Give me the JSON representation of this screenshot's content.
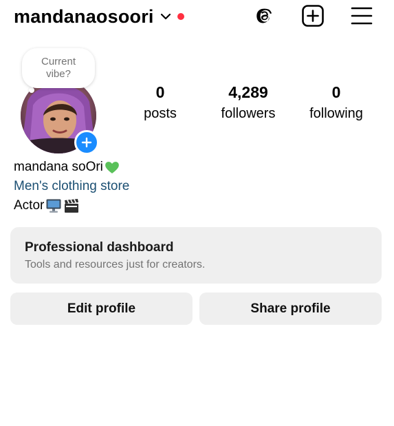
{
  "header": {
    "username": "mandanaosoori",
    "icons": {
      "account_switch": "chevron-down-icon",
      "threads": "threads-icon",
      "create": "plus-square-icon",
      "menu": "hamburger-menu-icon"
    }
  },
  "profile": {
    "note_prompt": {
      "line1": "Current",
      "line2": "vibe?"
    },
    "stats": {
      "posts_count": "0",
      "posts_label": "posts",
      "followers_count": "4,289",
      "followers_label": "followers",
      "following_count": "0",
      "following_label": "following"
    },
    "full_name": "mandana soOri",
    "category": "Men's clothing store",
    "bio": "Actor"
  },
  "dashboard": {
    "title": "Professional dashboard",
    "subtitle": "Tools and resources just for creators."
  },
  "actions": {
    "edit_profile": "Edit profile",
    "share_profile": "Share profile"
  },
  "colors": {
    "notification_dot": "#ff3040",
    "add_story": "#1a8cff",
    "category_link": "#1b4f72",
    "button_bg": "#efefef",
    "heart": "#5ac15a"
  }
}
